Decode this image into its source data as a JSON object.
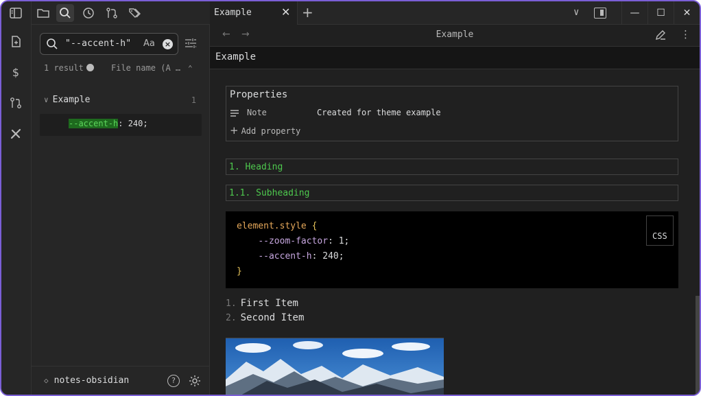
{
  "left_tabs": {
    "icons": [
      "sidebar-toggle-icon",
      "folder-icon",
      "search-icon",
      "clock-icon",
      "git-branch-icon",
      "tags-icon"
    ]
  },
  "ribbon": {
    "icons": [
      "file-plus-icon",
      "dollar-icon",
      "git-compare-icon",
      "tools-icon"
    ]
  },
  "search": {
    "query": "\"--accent-h\"",
    "case_label": "Aa",
    "result_count": "1 result",
    "sort_label": "File name (A …",
    "file": {
      "name": "Example",
      "count": "1"
    },
    "match": {
      "before": "",
      "highlight": "--accent-h",
      "after": ": 240;"
    }
  },
  "vault": {
    "name": "notes-obsidian",
    "help": "?"
  },
  "tabbar": {
    "tab_title": "Example",
    "close": "✕",
    "new_tab": "+",
    "window": {
      "minimize": "—",
      "maximize": "☐",
      "close": "✕"
    }
  },
  "editor": {
    "view_title": "Example",
    "inline_title": "Example",
    "back": "←",
    "forward": "→",
    "more": "⋮",
    "properties": {
      "title": "Properties",
      "rows": [
        {
          "key": "Note",
          "value": "Created for theme example"
        }
      ],
      "add_label": "Add property"
    },
    "headings": [
      {
        "text": "1. Heading"
      },
      {
        "text": "1.1. Subheading"
      }
    ],
    "code": {
      "lang": "CSS",
      "selector": "element.style",
      "open_brace": "{",
      "close_brace": "}",
      "lines": [
        {
          "prop": "--zoom-factor",
          "value": "1;"
        },
        {
          "prop": "--accent-h",
          "value": "240;"
        }
      ]
    },
    "list": [
      {
        "num": "1.",
        "text": "First Item"
      },
      {
        "num": "2.",
        "text": "Second Item"
      }
    ]
  },
  "colors": {
    "accent_border": "#7b5fd6",
    "heading_green": "#4ec94e",
    "highlight_bg": "#1e6a1e"
  }
}
